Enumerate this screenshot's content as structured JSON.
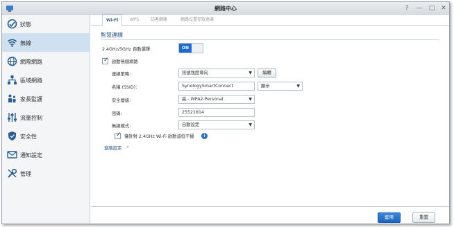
{
  "window": {
    "title": "網路中心",
    "controls": {
      "help": "?",
      "minimize": "—",
      "maximize": "□",
      "close": "✕"
    }
  },
  "sidebar": {
    "items": [
      {
        "label": "狀態",
        "icon": "status-icon",
        "active": false
      },
      {
        "label": "無線",
        "icon": "wifi-icon",
        "active": true
      },
      {
        "label": "網際網路",
        "icon": "globe-icon",
        "active": false
      },
      {
        "label": "區域網路",
        "icon": "local-network-icon",
        "active": false
      },
      {
        "label": "家長監護",
        "icon": "family-icon",
        "active": false
      },
      {
        "label": "流量控制",
        "icon": "sliders-icon",
        "active": false
      },
      {
        "label": "安全性",
        "icon": "shield-icon",
        "active": false
      },
      {
        "label": "通知設定",
        "icon": "notification-icon",
        "active": false
      },
      {
        "label": "管理",
        "icon": "tools-icon",
        "active": false
      }
    ]
  },
  "tabs": [
    "Wi-Fi",
    "WPS",
    "訪客網路",
    "網路位置存取過濾"
  ],
  "section": {
    "title": "智慧連線",
    "auto_switch_label": "2.4GHz/5GHz 自動選擇:",
    "toggle_on": "ON",
    "enable_wireless_label": "啟動無線網路",
    "connection_strategy_label": "連線策略:",
    "connection_strategy_value": "訊號強度導向",
    "edit_button": "編輯",
    "ssid_label": "名稱 (SSID):",
    "ssid_value": "SynologySmartConnect",
    "ssid_visibility": "顯示",
    "security_label": "安全層級:",
    "security_value": "高 - WPA2-Personal",
    "password_label": "密碼:",
    "password_value": "25521814",
    "mode_label": "無線模式:",
    "mode_value": "自動設定",
    "interference_label": "僅針對 2.4GHz Wi-Fi 啟動減低干擾",
    "advanced_link": "進階設定"
  },
  "footer": {
    "apply": "套用",
    "reset": "重置"
  },
  "colors": {
    "accent": "#1f6bd0",
    "sidebar_active": "#cfe0f0"
  }
}
